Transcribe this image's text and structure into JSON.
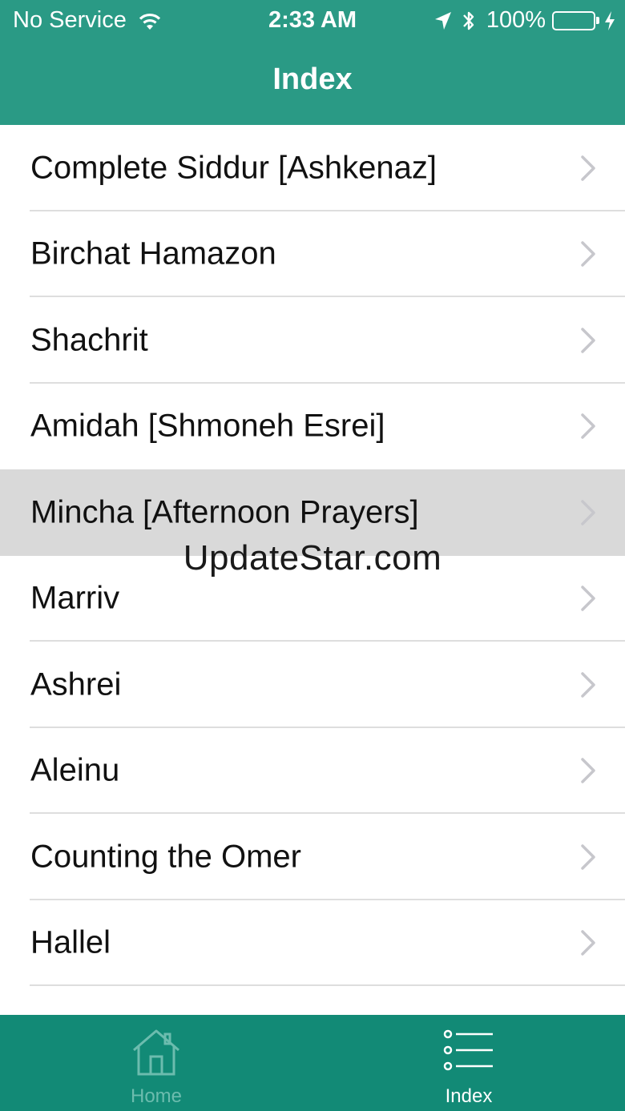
{
  "status_bar": {
    "carrier": "No Service",
    "time": "2:33 AM",
    "battery": "100%",
    "battery_color": "#4cd964"
  },
  "nav": {
    "title": "Index",
    "color": "#2a9a85"
  },
  "list": {
    "items": [
      {
        "label": "Complete Siddur [Ashkenaz]"
      },
      {
        "label": "Birchat Hamazon"
      },
      {
        "label": "Shachrit"
      },
      {
        "label": "Amidah [Shmoneh Esrei]"
      },
      {
        "label": "Mincha [Afternoon Prayers]"
      },
      {
        "label": "Marriv"
      },
      {
        "label": "Ashrei"
      },
      {
        "label": "Aleinu"
      },
      {
        "label": "Counting the Omer"
      },
      {
        "label": "Hallel"
      }
    ],
    "highlighted_item": "Mincha [Afternoon Prayers]"
  },
  "watermark": "UpdateStar.com",
  "tab_bar": {
    "color": "#128a76",
    "tabs": [
      {
        "label": "Home",
        "icon": "home-icon",
        "selected": false
      },
      {
        "label": "Index",
        "icon": "list-icon",
        "selected": true
      }
    ]
  }
}
